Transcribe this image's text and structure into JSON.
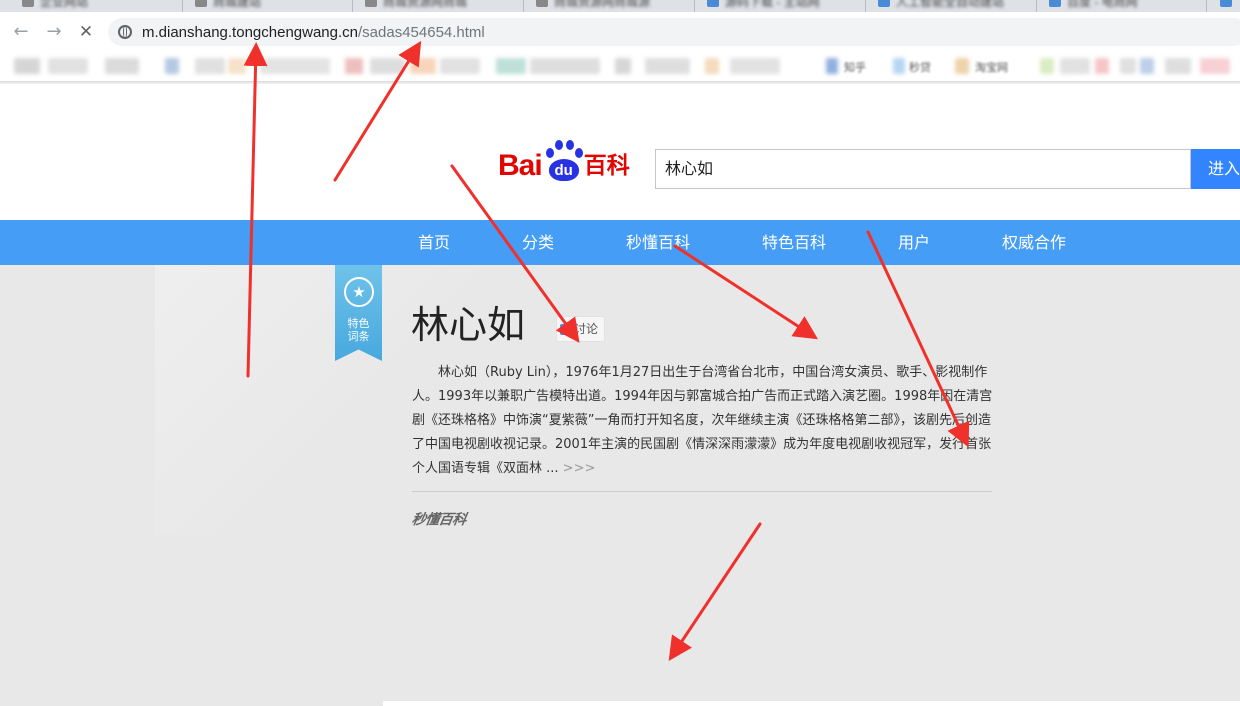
{
  "browser": {
    "tabs": [
      {
        "title": "企业网站"
      },
      {
        "title": "商城建站"
      },
      {
        "title": "商城资源网商城"
      },
      {
        "title": "商城资源网商城源"
      },
      {
        "title": "源码下载 - 主站网"
      },
      {
        "title": "人工智能全自动建站"
      },
      {
        "title": "百度 - 电商网"
      },
      {
        "title": ""
      }
    ],
    "url_host": "m.dianshang.tongchengwang.cn",
    "url_path": "/sadas454654.html",
    "bookmarks_visible_labels": [
      "知乎",
      "秒贷",
      "淘宝网"
    ]
  },
  "header": {
    "logo_bai": "Bai",
    "logo_du": "du",
    "logo_baike": "百科",
    "search_value": "林心如",
    "search_button": "进入"
  },
  "nav": {
    "items": [
      "首页",
      "分类",
      "秒懂百科",
      "特色百科",
      "用户",
      "权威合作"
    ]
  },
  "entry": {
    "badge": "特色词条",
    "title": "林心如",
    "discuss_label": "讨论",
    "summary": "林心如（Ruby Lin），1976年1月27日出生于台湾省台北市，中国台湾女演员、歌手、影视制作人。1993年以兼职广告模特出道。1994年因与郭富城合拍广告而正式踏入演艺圈。1998年因在清宫剧《还珠格格》中饰演“夏紫薇”一角而打开知名度，次年继续主演《还珠格格第二部》，该剧先后创造了中国电视剧收视记录。2001年主演的民国剧《情深深雨濛濛》成为年度电视剧收视冠军，发行首张个人国语专辑《双面林 ... ",
    "more": ">>>",
    "miaodong_label": "秒懂百科"
  },
  "colors": {
    "nav_blue": "#459df5",
    "logo_red": "#e10601",
    "logo_blue": "#2932e1",
    "arrow_red": "#f0302b"
  }
}
